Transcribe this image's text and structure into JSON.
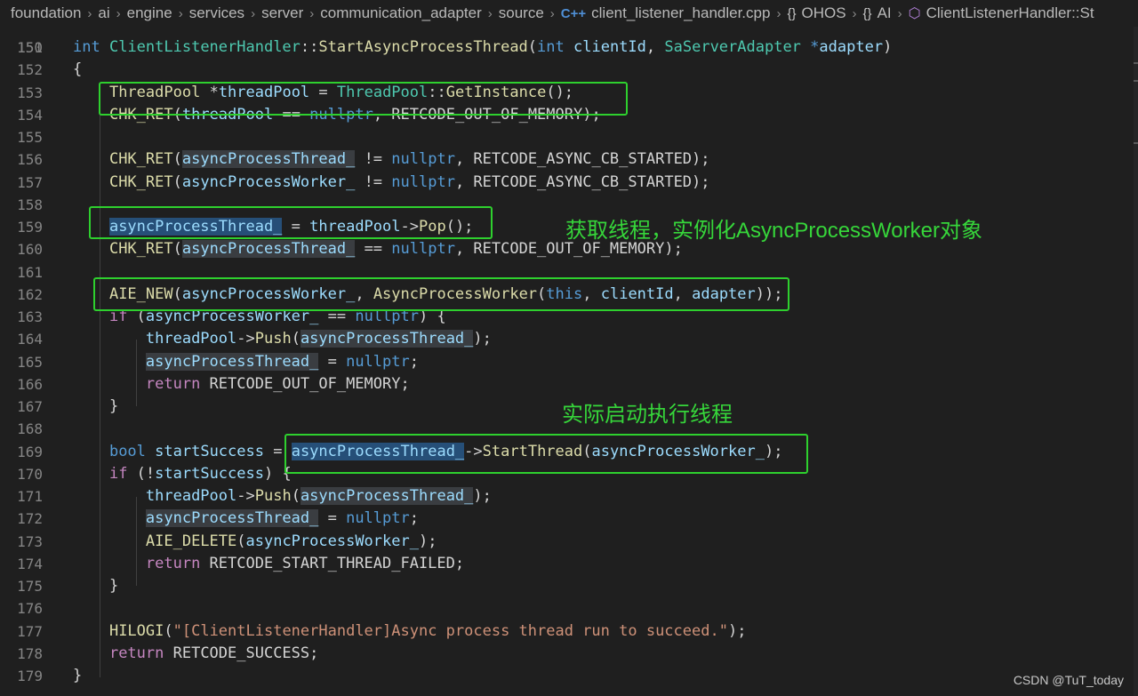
{
  "breadcrumb": {
    "items": [
      "foundation",
      "ai",
      "engine",
      "services",
      "server",
      "communication_adapter",
      "source"
    ],
    "file": "client_listener_handler.cpp",
    "file_icon": "C++",
    "ns1": "OHOS",
    "ns2": "AI",
    "symbol": "ClientListenerHandler::St",
    "ns_icon": "{}"
  },
  "editor": {
    "partial_top_line": "150",
    "lines": [
      {
        "n": "151"
      },
      {
        "n": "152"
      },
      {
        "n": "153"
      },
      {
        "n": "154"
      },
      {
        "n": "155"
      },
      {
        "n": "156"
      },
      {
        "n": "157"
      },
      {
        "n": "158"
      },
      {
        "n": "159"
      },
      {
        "n": "160"
      },
      {
        "n": "161"
      },
      {
        "n": "162"
      },
      {
        "n": "163"
      },
      {
        "n": "164"
      },
      {
        "n": "165"
      },
      {
        "n": "166"
      },
      {
        "n": "167"
      },
      {
        "n": "168"
      },
      {
        "n": "169"
      },
      {
        "n": "170"
      },
      {
        "n": "171"
      },
      {
        "n": "172"
      },
      {
        "n": "173"
      },
      {
        "n": "174"
      },
      {
        "n": "175"
      },
      {
        "n": "176"
      },
      {
        "n": "177"
      },
      {
        "n": "178"
      },
      {
        "n": "179"
      }
    ]
  },
  "annotations": {
    "note1": "获取线程，实例化AsyncProcessWorker对象",
    "note2": "实际启动执行线程"
  },
  "watermark": "CSDN @TuT_today",
  "colors": {
    "annotation": "#2ed02e",
    "keyword": "#569cd6",
    "type": "#4ec9b0",
    "function": "#dcdcaa",
    "variable": "#9cdcfe",
    "string": "#ce9178"
  }
}
